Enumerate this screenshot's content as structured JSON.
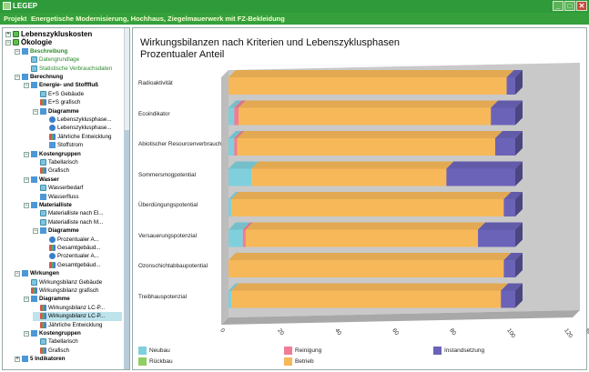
{
  "window": {
    "title": "LEGEP",
    "buttons": [
      "_",
      "□",
      "✕"
    ]
  },
  "project": {
    "label": "Projekt",
    "name": "Energetische Modernisierung, Hochhaus, Ziegelmauerwerk mit FZ-Bekleidung"
  },
  "tree": [
    {
      "label": "Lebenszykluskosten",
      "level": 0,
      "toggle": "+",
      "icon": "leaf",
      "bold": true,
      "big": true
    },
    {
      "label": "Ökologie",
      "level": 0,
      "toggle": "−",
      "icon": "leaf",
      "bold": true,
      "big": true
    },
    {
      "label": "Beschreibung",
      "level": 1,
      "toggle": "−",
      "icon": "fold",
      "bold": true,
      "green": true
    },
    {
      "label": "Datengrundlage",
      "level": 2,
      "toggle": "",
      "icon": "doc",
      "green": true
    },
    {
      "label": "Statistische Verbrauchsdaten",
      "level": 2,
      "toggle": "",
      "icon": "doc",
      "green": true
    },
    {
      "label": "Berechnung",
      "level": 1,
      "toggle": "−",
      "icon": "fold",
      "bold": true
    },
    {
      "label": "Energie- und Stofffluß",
      "level": 2,
      "toggle": "−",
      "icon": "fold",
      "bold": true
    },
    {
      "label": "E+S Gebäude",
      "level": 3,
      "toggle": "",
      "icon": "doc"
    },
    {
      "label": "E+S grafisch",
      "level": 3,
      "toggle": "",
      "icon": "chart"
    },
    {
      "label": "Diagramme",
      "level": 3,
      "toggle": "−",
      "icon": "fold",
      "bold": true
    },
    {
      "label": "Lebenszyklusphase...",
      "level": 4,
      "toggle": "",
      "icon": "pie"
    },
    {
      "label": "Lebenszyklusphase...",
      "level": 4,
      "toggle": "",
      "icon": "pie"
    },
    {
      "label": "Jährliche Entwicklung",
      "level": 4,
      "toggle": "",
      "icon": "chart"
    },
    {
      "label": "Stoffstrom",
      "level": 4,
      "toggle": "",
      "icon": "fold"
    },
    {
      "label": "Kostengruppen",
      "level": 2,
      "toggle": "−",
      "icon": "fold",
      "bold": true
    },
    {
      "label": "Tabellarisch",
      "level": 3,
      "toggle": "",
      "icon": "doc"
    },
    {
      "label": "Grafisch",
      "level": 3,
      "toggle": "",
      "icon": "chart"
    },
    {
      "label": "Wasser",
      "level": 2,
      "toggle": "−",
      "icon": "fold",
      "bold": true
    },
    {
      "label": "Wasserbedarf",
      "level": 3,
      "toggle": "",
      "icon": "doc"
    },
    {
      "label": "Wasserfluss",
      "level": 3,
      "toggle": "",
      "icon": "fold"
    },
    {
      "label": "Materialliste",
      "level": 2,
      "toggle": "−",
      "icon": "fold",
      "bold": true
    },
    {
      "label": "Materialliste nach El...",
      "level": 3,
      "toggle": "",
      "icon": "doc"
    },
    {
      "label": "Materialliste nach M...",
      "level": 3,
      "toggle": "",
      "icon": "doc"
    },
    {
      "label": "Diagramme",
      "level": 3,
      "toggle": "−",
      "icon": "fold",
      "bold": true
    },
    {
      "label": "Prozentualer A...",
      "level": 4,
      "toggle": "",
      "icon": "pie"
    },
    {
      "label": "Gesamtgebäud...",
      "level": 4,
      "toggle": "",
      "icon": "chart"
    },
    {
      "label": "Prozentualer A...",
      "level": 4,
      "toggle": "",
      "icon": "pie"
    },
    {
      "label": "Gesamtgebäud...",
      "level": 4,
      "toggle": "",
      "icon": "chart"
    },
    {
      "label": "Wirkungen",
      "level": 1,
      "toggle": "−",
      "icon": "fold",
      "bold": true
    },
    {
      "label": "Wirkungsbilanz Gebäude",
      "level": 2,
      "toggle": "",
      "icon": "doc"
    },
    {
      "label": "Wirkungsbilanz grafisch",
      "level": 2,
      "toggle": "",
      "icon": "chart"
    },
    {
      "label": "Diagramme",
      "level": 2,
      "toggle": "−",
      "icon": "fold",
      "bold": true
    },
    {
      "label": "Wirkungsbilanz LC-P...",
      "level": 3,
      "toggle": "",
      "icon": "chart"
    },
    {
      "label": "Wirkungsbilanz LC-P...",
      "level": 3,
      "toggle": "",
      "icon": "chart",
      "selected": true
    },
    {
      "label": "Jährliche Entwicklung",
      "level": 3,
      "toggle": "",
      "icon": "chart"
    },
    {
      "label": "Kostengruppen",
      "level": 2,
      "toggle": "−",
      "icon": "fold",
      "bold": true
    },
    {
      "label": "Tabellarisch",
      "level": 3,
      "toggle": "",
      "icon": "doc"
    },
    {
      "label": "Grafisch",
      "level": 3,
      "toggle": "",
      "icon": "chart"
    },
    {
      "label": "5 Indikatoren",
      "level": 1,
      "toggle": "+",
      "icon": "fold",
      "bold": true
    }
  ],
  "chart_data": {
    "type": "bar",
    "orientation": "horizontal",
    "stacked": true,
    "percent": true,
    "title": "Wirkungsbilanzen nach Kriterien und Lebenszyklusphasen\nProzentualer Anteil",
    "categories": [
      "Radioaktivität",
      "Ecoindikator",
      "Abiotischer Resourcenverbrauch",
      "Sommersmogpotential",
      "Überdüngungspotential",
      "Versauerungspotenzial",
      "Ozonschichtabbaupotential",
      "Treibhauspotenzial"
    ],
    "series": [
      {
        "name": "Neubau",
        "color": "#7fd0dc",
        "values": [
          0,
          2,
          2,
          8,
          1,
          5,
          0,
          1
        ]
      },
      {
        "name": "Rückbau",
        "color": "#8fce63",
        "values": [
          0,
          0,
          0,
          0,
          0,
          0,
          0,
          0
        ]
      },
      {
        "name": "Reinigung",
        "color": "#f07c96",
        "values": [
          0,
          1.5,
          1,
          0,
          0,
          1,
          0,
          0
        ]
      },
      {
        "name": "Betrieb",
        "color": "#f6b859",
        "values": [
          97,
          88,
          90,
          68,
          95,
          81,
          96,
          94
        ]
      },
      {
        "name": "Instandsetzung",
        "color": "#6b63b8",
        "values": [
          3,
          8.5,
          7,
          24,
          4,
          13,
          4,
          5
        ]
      }
    ],
    "xlim": [
      0,
      120
    ],
    "xticks": [
      "0",
      "20",
      "40",
      "60",
      "80",
      "100",
      "120"
    ],
    "xunit": "%",
    "legend_placement": "bottom"
  }
}
